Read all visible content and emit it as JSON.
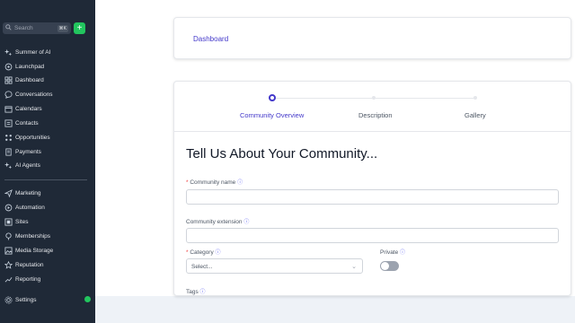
{
  "sidebar": {
    "search": {
      "placeholder": "Search",
      "shortcut": "⌘K",
      "add": "+"
    },
    "items": [
      {
        "label": "Summer of AI",
        "icon": "sparkle-icon"
      },
      {
        "label": "Launchpad",
        "icon": "rocket-icon"
      },
      {
        "label": "Dashboard",
        "icon": "dashboard-icon"
      },
      {
        "label": "Conversations",
        "icon": "chat-icon"
      },
      {
        "label": "Calendars",
        "icon": "calendar-icon"
      },
      {
        "label": "Contacts",
        "icon": "contacts-icon"
      },
      {
        "label": "Opportunities",
        "icon": "opportunities-icon"
      },
      {
        "label": "Payments",
        "icon": "payments-icon"
      },
      {
        "label": "AI Agents",
        "icon": "sparkle-icon"
      },
      {
        "label": "Marketing",
        "icon": "send-icon"
      },
      {
        "label": "Automation",
        "icon": "automation-icon"
      },
      {
        "label": "Sites",
        "icon": "sites-icon"
      },
      {
        "label": "Memberships",
        "icon": "memberships-icon"
      },
      {
        "label": "Media Storage",
        "icon": "image-icon"
      },
      {
        "label": "Reputation",
        "icon": "star-icon"
      },
      {
        "label": "Reporting",
        "icon": "trend-icon"
      },
      {
        "label": "Settings",
        "icon": "gear-icon"
      }
    ]
  },
  "dashboard_card": {
    "link": "Dashboard"
  },
  "stepper": {
    "steps": [
      "Community Overview",
      "Description",
      "Gallery"
    ],
    "active_index": 0
  },
  "form": {
    "heading": "Tell Us About Your Community...",
    "community_name": {
      "required_mark": "*",
      "label": "Community name",
      "info": "ⓘ",
      "value": ""
    },
    "community_extension": {
      "label": "Community extension",
      "info": "ⓘ",
      "value": ""
    },
    "category": {
      "required_mark": "*",
      "label": "Category",
      "info": "ⓘ",
      "selected": "Select..."
    },
    "private": {
      "label": "Private",
      "info": "ⓘ",
      "on": false
    },
    "tags": {
      "label": "Tags",
      "info": "ⓘ"
    }
  },
  "colors": {
    "sidebar_bg": "#1f2937",
    "accent": "#4338ca",
    "add_button": "#22c55e"
  }
}
